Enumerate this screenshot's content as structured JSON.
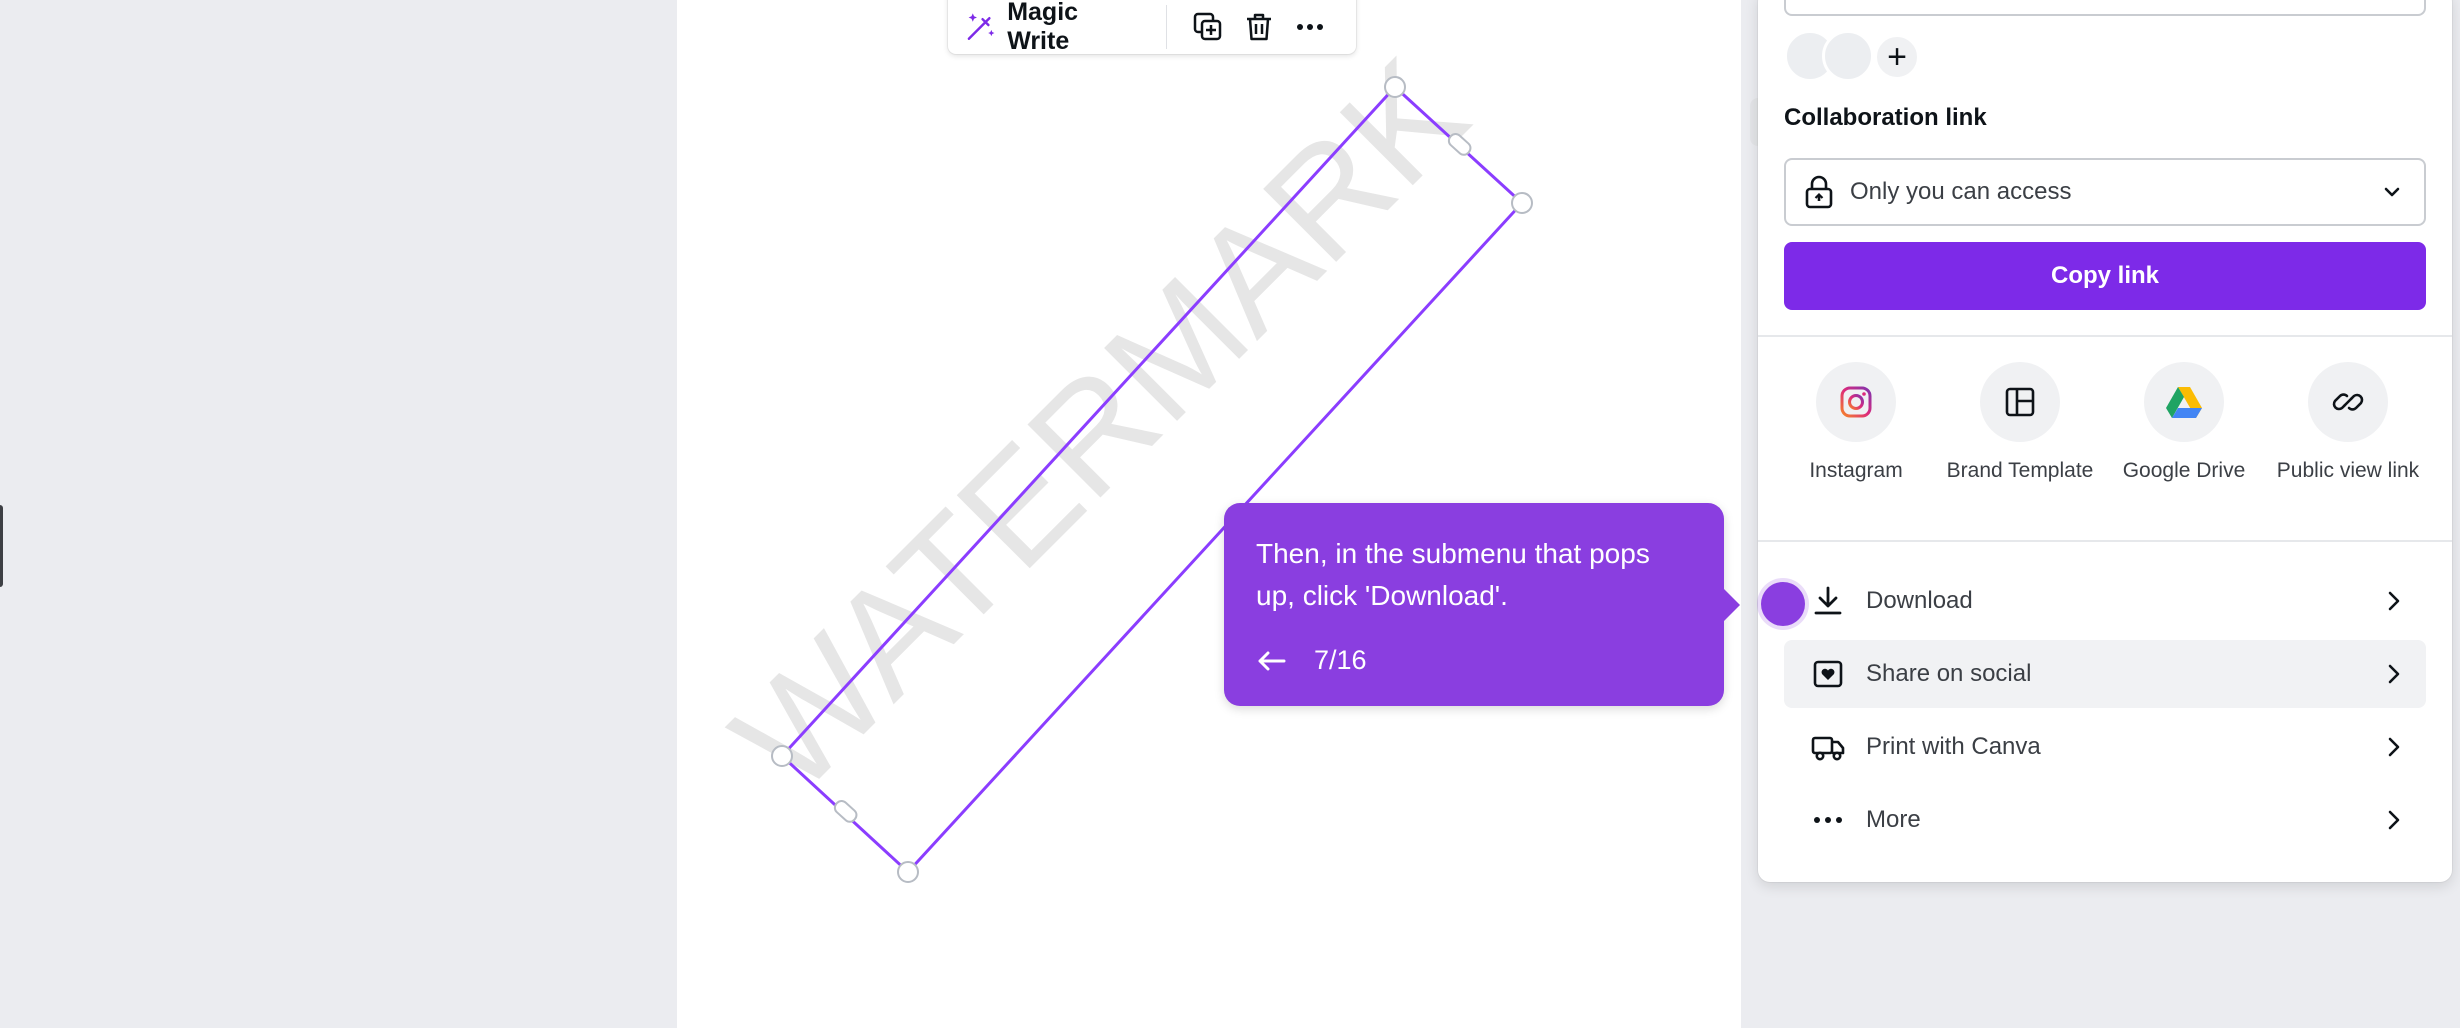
{
  "toolbar": {
    "magic_write_label": "Magic Write",
    "icons": [
      "magic-wand-icon",
      "duplicate-icon",
      "trash-icon",
      "more-icon"
    ]
  },
  "canvas": {
    "watermark_text": "WATERMARK"
  },
  "panel": {
    "collaboration_label": "Collaboration link",
    "access_value": "Only you can access",
    "copy_link_label": "Copy link",
    "add_person_symbol": "+",
    "share_targets": [
      {
        "label": "Instagram",
        "icon": "instagram-icon"
      },
      {
        "label": "Brand Template",
        "icon": "brand-template-icon"
      },
      {
        "label": "Google Drive",
        "icon": "google-drive-icon"
      },
      {
        "label": "Public view link",
        "icon": "link-icon"
      }
    ],
    "menu": [
      {
        "label": "Download",
        "icon": "download-icon"
      },
      {
        "label": "Share on social",
        "icon": "heart-square-icon"
      },
      {
        "label": "Print with Canva",
        "icon": "truck-icon"
      },
      {
        "label": "More",
        "icon": "more-icon"
      }
    ]
  },
  "tooltip": {
    "text": "Then, in the submenu that pops up, click 'Download'.",
    "progress": "7/16"
  },
  "colors": {
    "accent": "#7d2ae8",
    "tooltip": "#8a3ee0",
    "selection": "#8b3dff"
  }
}
